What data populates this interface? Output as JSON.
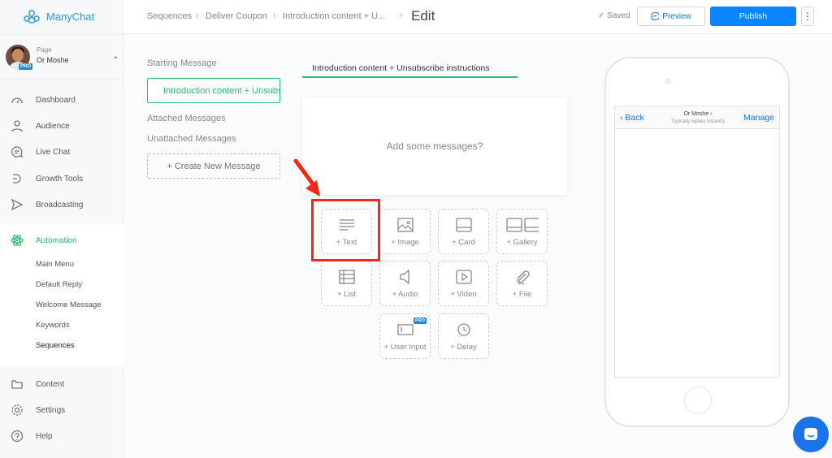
{
  "app": {
    "name": "ManyChat",
    "brand_color": "#2a9bd8",
    "accent_color": "#23c16b",
    "primary_button_color": "#0a84ff",
    "highlight_color": "#ee2a14"
  },
  "page_selector": {
    "label": "Page",
    "name": "Or Moshe",
    "badge": "PRO"
  },
  "sidebar": {
    "items": [
      {
        "label": "Dashboard",
        "icon": "dashboard-icon"
      },
      {
        "label": "Audience",
        "icon": "person-icon"
      },
      {
        "label": "Live Chat",
        "icon": "chat-bubble-icon"
      },
      {
        "label": "Growth Tools",
        "icon": "growth-icon"
      },
      {
        "label": "Broadcasting",
        "icon": "send-icon"
      },
      {
        "label": "Automation",
        "icon": "atom-icon",
        "active": true
      },
      {
        "label": "Content",
        "icon": "folder-icon"
      },
      {
        "label": "Settings",
        "icon": "gear-icon"
      },
      {
        "label": "Help",
        "icon": "help-icon"
      }
    ],
    "automation_sub": [
      "Main Menu",
      "Default Reply",
      "Welcome Message",
      "Keywords",
      "Sequences"
    ],
    "active_sub": "Sequences"
  },
  "breadcrumb": [
    "Sequences",
    "Deliver Coupon",
    "Introduction content + U..."
  ],
  "header": {
    "title": "Edit",
    "saved_label": "Saved",
    "preview_label": "Preview",
    "publish_label": "Publish",
    "more_label": "⋮"
  },
  "left_panel": {
    "starting_message_label": "Starting Message",
    "starting_message_value": "Introduction content + Unsubscribe instructions",
    "attached_label": "Attached Messages",
    "unattached_label": "Unattached Messages",
    "create_label": "+ Create New Message"
  },
  "editor": {
    "title": "Introduction content + Unsubscribe instructions",
    "placeholder": "Add some messages?",
    "blocks": [
      {
        "label": "+ Text",
        "icon": "text-lines-icon"
      },
      {
        "label": "+ Image",
        "icon": "image-icon"
      },
      {
        "label": "+ Card",
        "icon": "card-icon"
      },
      {
        "label": "+ Gallery",
        "icon": "gallery-icon"
      },
      {
        "label": "+ List",
        "icon": "list-icon"
      },
      {
        "label": "+ Audio",
        "icon": "speaker-icon"
      },
      {
        "label": "+ Video",
        "icon": "video-icon"
      },
      {
        "label": "+ File",
        "icon": "paperclip-icon"
      },
      {
        "label": "+ User Input",
        "icon": "input-icon",
        "badge": "PRO"
      },
      {
        "label": "+ Delay",
        "icon": "clock-icon"
      }
    ]
  },
  "phone_preview": {
    "back_label": "Back",
    "name": "Or Moshe",
    "subtitle": "Typically replies instantly",
    "manage_label": "Manage"
  }
}
